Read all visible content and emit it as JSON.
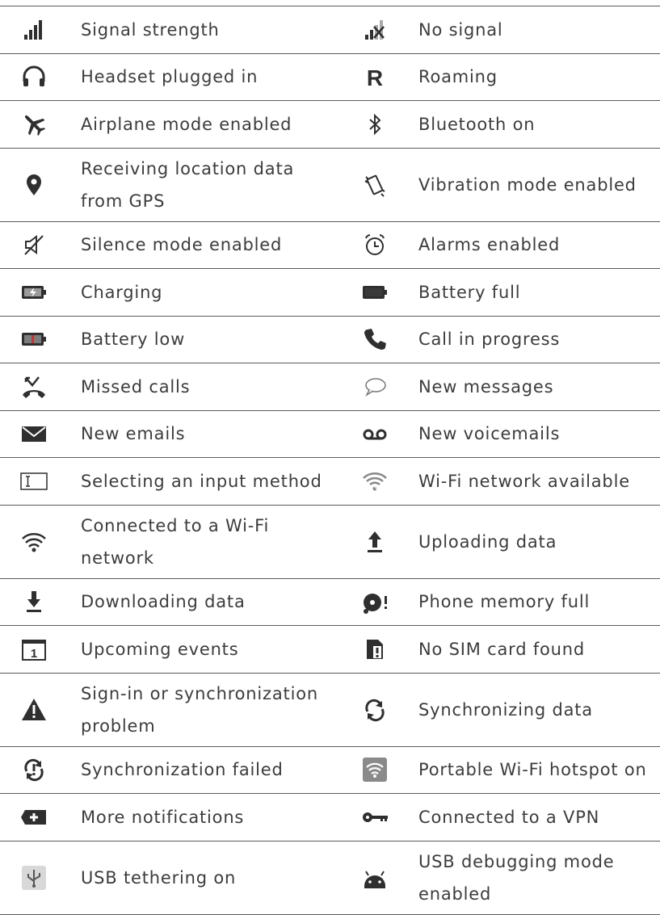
{
  "rows": [
    {
      "left": {
        "icon": "signal-strength-icon",
        "label": "Signal strength"
      },
      "right": {
        "icon": "no-signal-icon",
        "label": "No signal"
      }
    },
    {
      "left": {
        "icon": "headset-icon",
        "label": "Headset plugged in"
      },
      "right": {
        "icon": "roaming-icon",
        "label": "Roaming"
      }
    },
    {
      "left": {
        "icon": "airplane-icon",
        "label": "Airplane mode enabled"
      },
      "right": {
        "icon": "bluetooth-icon",
        "label": "Bluetooth on"
      }
    },
    {
      "left": {
        "icon": "location-pin-icon",
        "label": "Receiving location data",
        "label2": "from GPS"
      },
      "right": {
        "icon": "vibration-icon",
        "label": "Vibration mode enabled"
      }
    },
    {
      "left": {
        "icon": "silence-icon",
        "label": "Silence mode enabled"
      },
      "right": {
        "icon": "alarm-icon",
        "label": "Alarms enabled"
      }
    },
    {
      "left": {
        "icon": "battery-charging-icon",
        "label": "Charging"
      },
      "right": {
        "icon": "battery-full-icon",
        "label": "Battery full"
      }
    },
    {
      "left": {
        "icon": "battery-low-icon",
        "label": "Battery low"
      },
      "right": {
        "icon": "call-icon",
        "label": "Call in progress"
      }
    },
    {
      "left": {
        "icon": "missed-call-icon",
        "label": "Missed calls"
      },
      "right": {
        "icon": "message-icon",
        "label": "New messages"
      }
    },
    {
      "left": {
        "icon": "email-icon",
        "label": "New emails"
      },
      "right": {
        "icon": "voicemail-icon",
        "label": "New voicemails"
      }
    },
    {
      "left": {
        "icon": "input-method-icon",
        "label": "Selecting an input method"
      },
      "right": {
        "icon": "wifi-available-icon",
        "label": "Wi-Fi network available"
      }
    },
    {
      "left": {
        "icon": "wifi-connected-icon",
        "label": "Connected to a Wi-Fi",
        "label2": "network"
      },
      "right": {
        "icon": "upload-icon",
        "label": "Uploading data"
      }
    },
    {
      "left": {
        "icon": "download-icon",
        "label": "Downloading data"
      },
      "right": {
        "icon": "memory-full-icon",
        "label": "Phone memory full"
      }
    },
    {
      "left": {
        "icon": "calendar-icon",
        "label": "Upcoming events",
        "icon_text": "1"
      },
      "right": {
        "icon": "no-sim-icon",
        "label": "No SIM card found"
      }
    },
    {
      "left": {
        "icon": "warning-icon",
        "label": "Sign-in or synchronization",
        "label2": "problem"
      },
      "right": {
        "icon": "sync-icon",
        "label": "Synchronizing data"
      }
    },
    {
      "left": {
        "icon": "sync-failed-icon",
        "label": "Synchronization failed"
      },
      "right": {
        "icon": "hotspot-icon",
        "label": "Portable Wi-Fi hotspot on"
      }
    },
    {
      "left": {
        "icon": "more-notifications-icon",
        "label": "More notifications"
      },
      "right": {
        "icon": "vpn-key-icon",
        "label": "Connected to a VPN"
      }
    },
    {
      "left": {
        "icon": "usb-icon",
        "label": "USB tethering on"
      },
      "right": {
        "icon": "android-debug-icon",
        "label": "USB debugging mode",
        "label2": "enabled"
      }
    }
  ]
}
